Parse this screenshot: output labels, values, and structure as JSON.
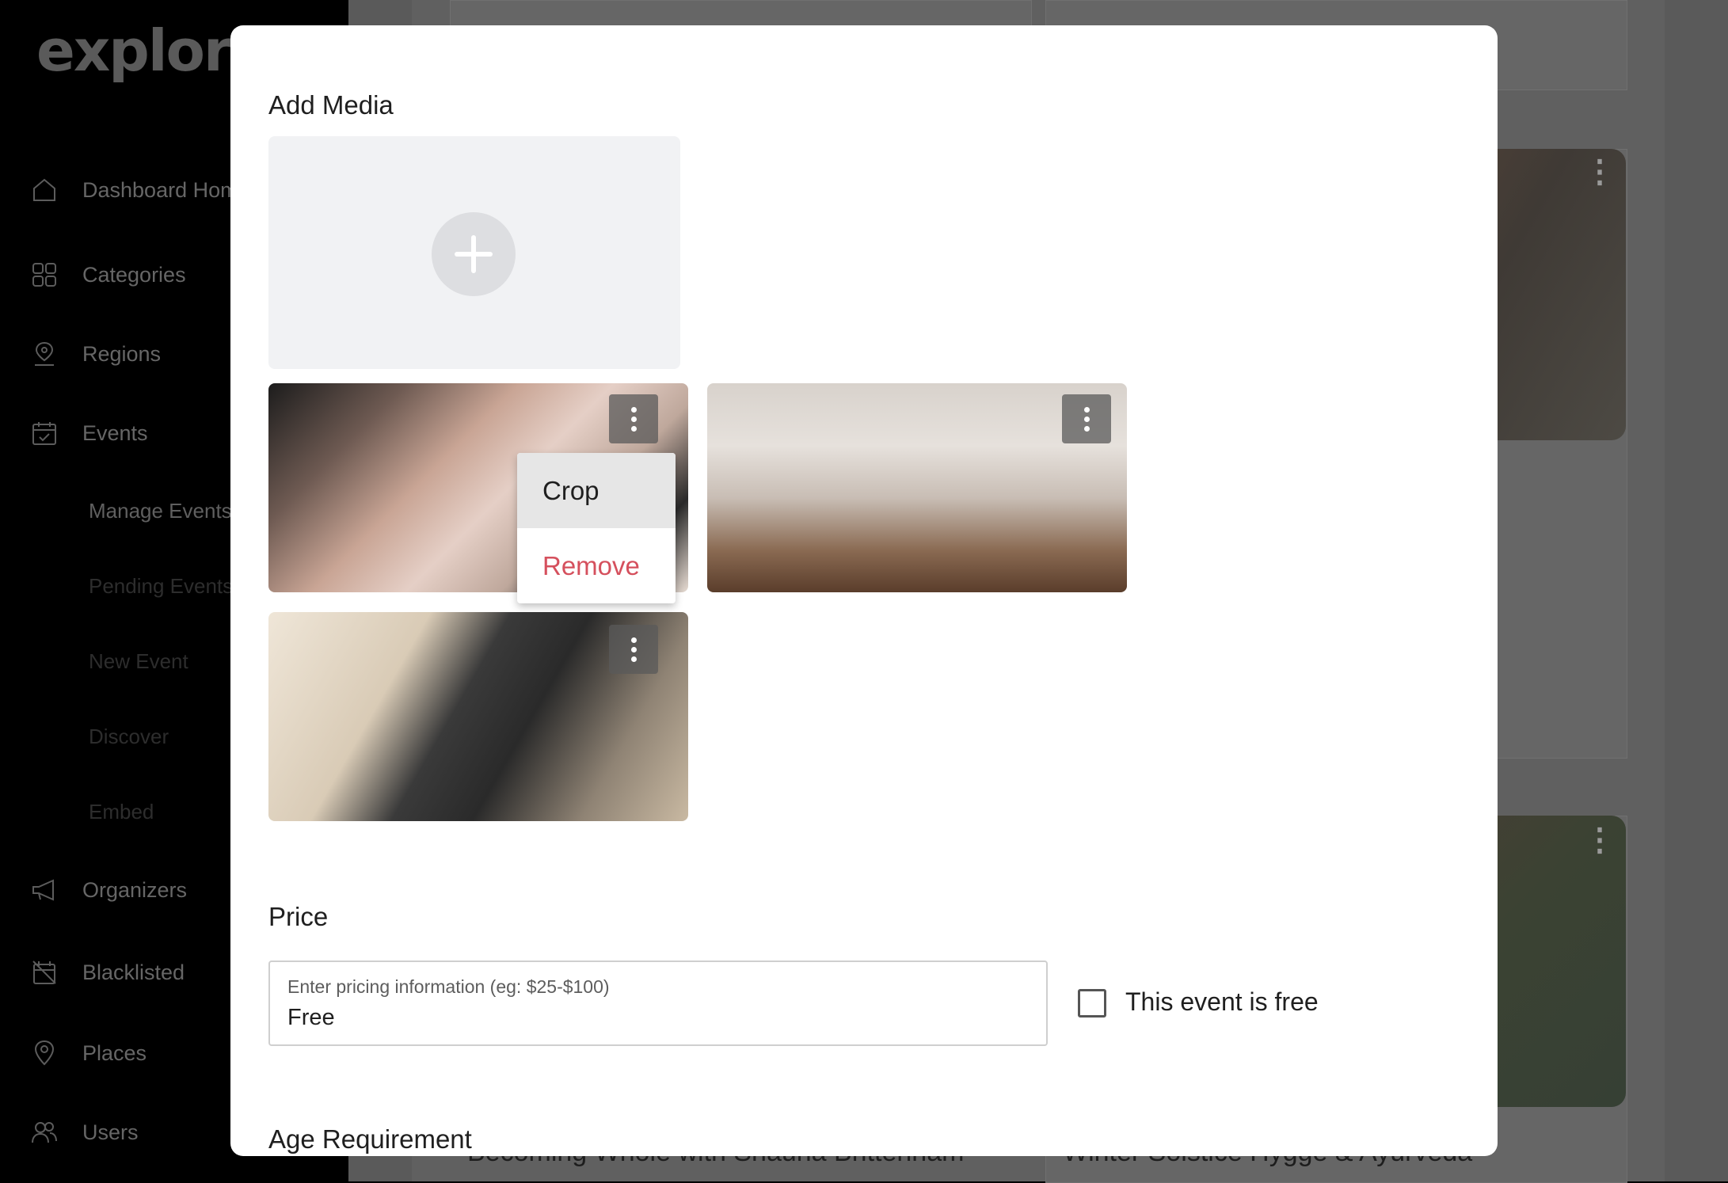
{
  "brand": {
    "logo": "explore"
  },
  "sidebar": {
    "items": [
      {
        "label": "Dashboard Home",
        "icon": "home-icon"
      },
      {
        "label": "Categories",
        "icon": "grid-icon"
      },
      {
        "label": "Regions",
        "icon": "user-pin-icon"
      },
      {
        "label": "Events",
        "icon": "calendar-check-icon"
      }
    ],
    "event_sub_items": [
      "Manage Events",
      "Pending Events",
      "New Event",
      "Discover",
      "Embed"
    ],
    "items_bottom": [
      {
        "label": "Organizers",
        "icon": "megaphone-icon"
      },
      {
        "label": "Blacklisted",
        "icon": "blocked-calendar-icon"
      },
      {
        "label": "Places",
        "icon": "map-pin-icon"
      },
      {
        "label": "Users",
        "icon": "users-icon"
      }
    ]
  },
  "background": {
    "card_titles": [
      "Becoming Whole with Shauna Brittenham",
      "Winter Solstice Hygge & Ayurveda"
    ]
  },
  "modal": {
    "add_media_title": "Add Media",
    "media_menu": {
      "crop": "Crop",
      "remove": "Remove"
    },
    "price_title": "Price",
    "price_placeholder": "Enter pricing information (eg: $25-$100)",
    "price_value": "Free",
    "free_checkbox_label": "This event is free",
    "age_title": "Age Requirement"
  }
}
